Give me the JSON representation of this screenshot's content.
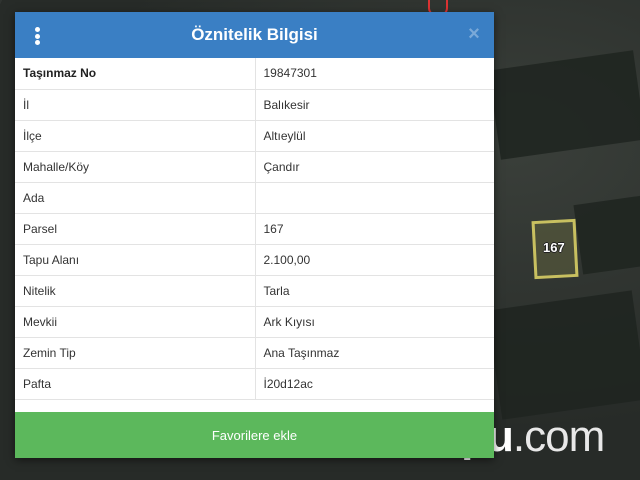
{
  "dialog": {
    "title": "Öznitelik Bilgisi",
    "rows": [
      {
        "key": "Taşınmaz No",
        "value": "19847301"
      },
      {
        "key": "İl",
        "value": "Balıkesir"
      },
      {
        "key": "İlçe",
        "value": "Altıeylül"
      },
      {
        "key": "Mahalle/Köy",
        "value": "Çandır"
      },
      {
        "key": "Ada",
        "value": ""
      },
      {
        "key": "Parsel",
        "value": "167"
      },
      {
        "key": "Tapu Alanı",
        "value": "2.100,00"
      },
      {
        "key": "Nitelik",
        "value": "Tarla"
      },
      {
        "key": "Mevkii",
        "value": "Ark Kıyısı"
      },
      {
        "key": "Zemin Tip",
        "value": "Ana Taşınmaz"
      },
      {
        "key": "Pafta",
        "value": "İ20d12ac"
      }
    ],
    "favorite_button": "Favorilere ekle",
    "close_symbol": "×"
  },
  "map": {
    "parcel_label": "167",
    "watermark_main": "tapu",
    "watermark_domain": ".com"
  },
  "colors": {
    "header_blue": "#3a7fc4",
    "button_green": "#5cb85c",
    "parcel_outline": "#c8c060"
  },
  "icons": {
    "menu": "vertical-dots-icon",
    "close": "close-icon"
  }
}
